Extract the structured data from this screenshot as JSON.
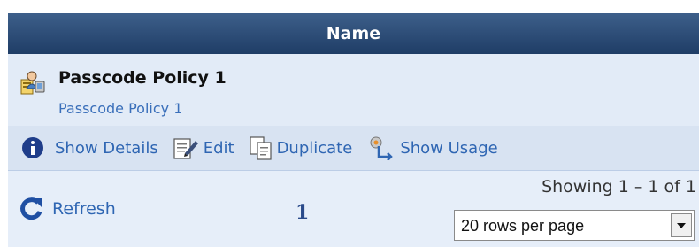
{
  "header": {
    "column_name": "Name"
  },
  "policy_row": {
    "icon": "policy-icon",
    "title": "Passcode Policy 1",
    "subtitle": "Passcode Policy 1"
  },
  "actions": [
    {
      "label": "Show Details",
      "icon": "info-icon"
    },
    {
      "label": "Edit",
      "icon": "edit-icon"
    },
    {
      "label": "Duplicate",
      "icon": "duplicate-icon"
    },
    {
      "label": "Show Usage",
      "icon": "usage-icon"
    }
  ],
  "footer": {
    "refresh_label": "Refresh",
    "refresh_icon": "refresh-icon",
    "current_page": "1",
    "showing_text": "Showing 1 – 1 of 1",
    "rows_per_page": "20 rows per page"
  },
  "colors": {
    "header_bg": "#2a4a75",
    "row_bg": "#e2ebf7",
    "link": "#2f66b3",
    "action_bar_bg": "#d8e3f2"
  }
}
